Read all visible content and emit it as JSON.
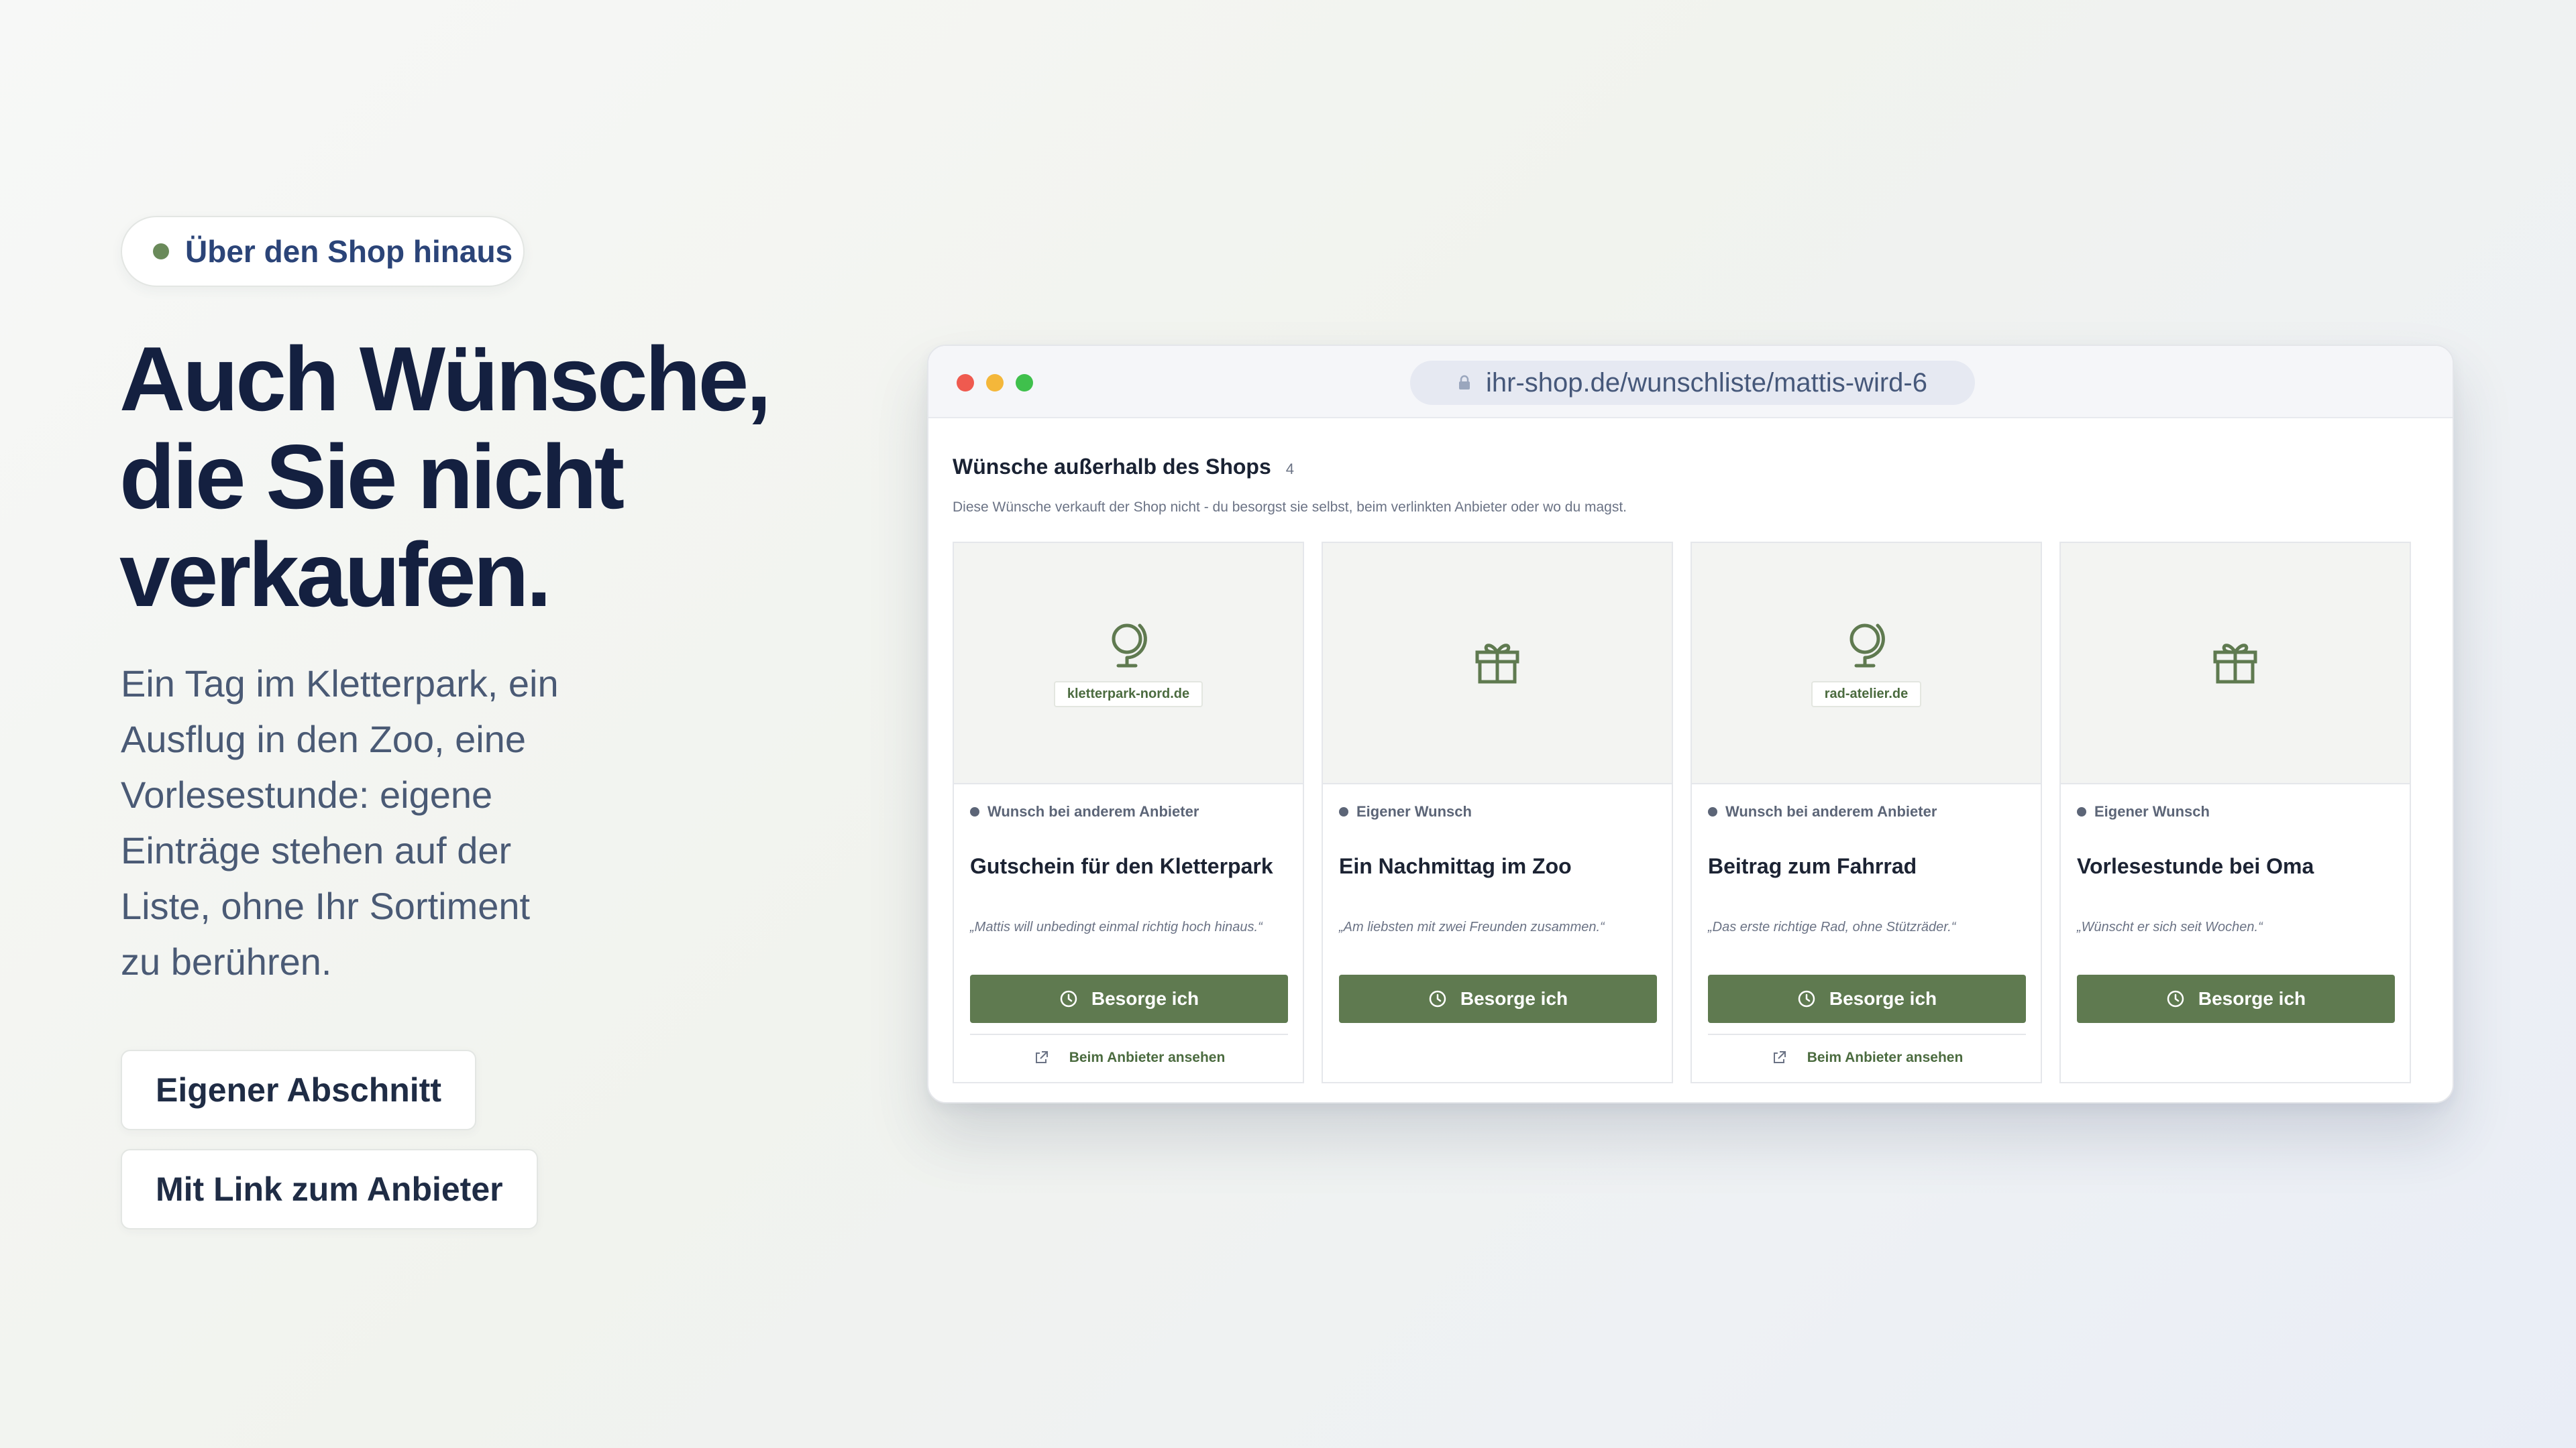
{
  "hero": {
    "pill": "Über den Shop hinaus",
    "title_lines": [
      "Auch Wünsche,",
      "die Sie nicht",
      "verkaufen."
    ],
    "desc_lines": [
      "Ein Tag im Kletterpark, ein",
      "Ausflug in den Zoo, eine",
      "Vorlesestunde: eigene",
      "Einträge stehen auf der",
      "Liste, ohne Ihr Sortiment",
      "zu berühren."
    ],
    "tags": [
      "Eigener Abschnitt",
      "Mit Link zum Anbieter"
    ]
  },
  "browser": {
    "url": "ihr-shop.de/wunschliste/mattis-wird-6"
  },
  "section": {
    "title": "Wünsche außerhalb des Shops",
    "count": "4",
    "subtitle": "Diese Wünsche verkauft der Shop nicht - du besorgst sie selbst, beim verlinkten Anbieter oder wo du magst."
  },
  "cards": [
    {
      "media_icon": "globe-icon",
      "domain": "kletterpark-nord.de",
      "badge": "Wunsch bei anderem Anbieter",
      "title": "Gutschein für den Kletterpark",
      "quote": "„Mattis will unbedingt einmal richtig hoch hinaus.“",
      "cta": "Besorge ich",
      "link": "Beim Anbieter ansehen"
    },
    {
      "media_icon": "gift-icon",
      "badge": "Eigener Wunsch",
      "title": "Ein Nachmittag im Zoo",
      "quote": "„Am liebsten mit zwei Freunden zusammen.“",
      "cta": "Besorge ich"
    },
    {
      "media_icon": "globe-icon",
      "domain": "rad-atelier.de",
      "badge": "Wunsch bei anderem Anbieter",
      "title": "Beitrag zum Fahrrad",
      "quote": "„Das erste richtige Rad, ohne Stützräder.“",
      "cta": "Besorge ich",
      "link": "Beim Anbieter ansehen"
    },
    {
      "media_icon": "gift-icon",
      "badge": "Eigener Wunsch",
      "title": "Vorlesestunde bei Oma",
      "quote": "„Wünscht er sich seit Wochen.“",
      "cta": "Besorge ich"
    }
  ],
  "colors": {
    "accent": "#5f7a50",
    "heading": "#142040",
    "pill_text": "#2b4478",
    "traffic_red": "#ef5a4f",
    "traffic_yellow": "#f4b73a",
    "traffic_green": "#3fc04c"
  }
}
